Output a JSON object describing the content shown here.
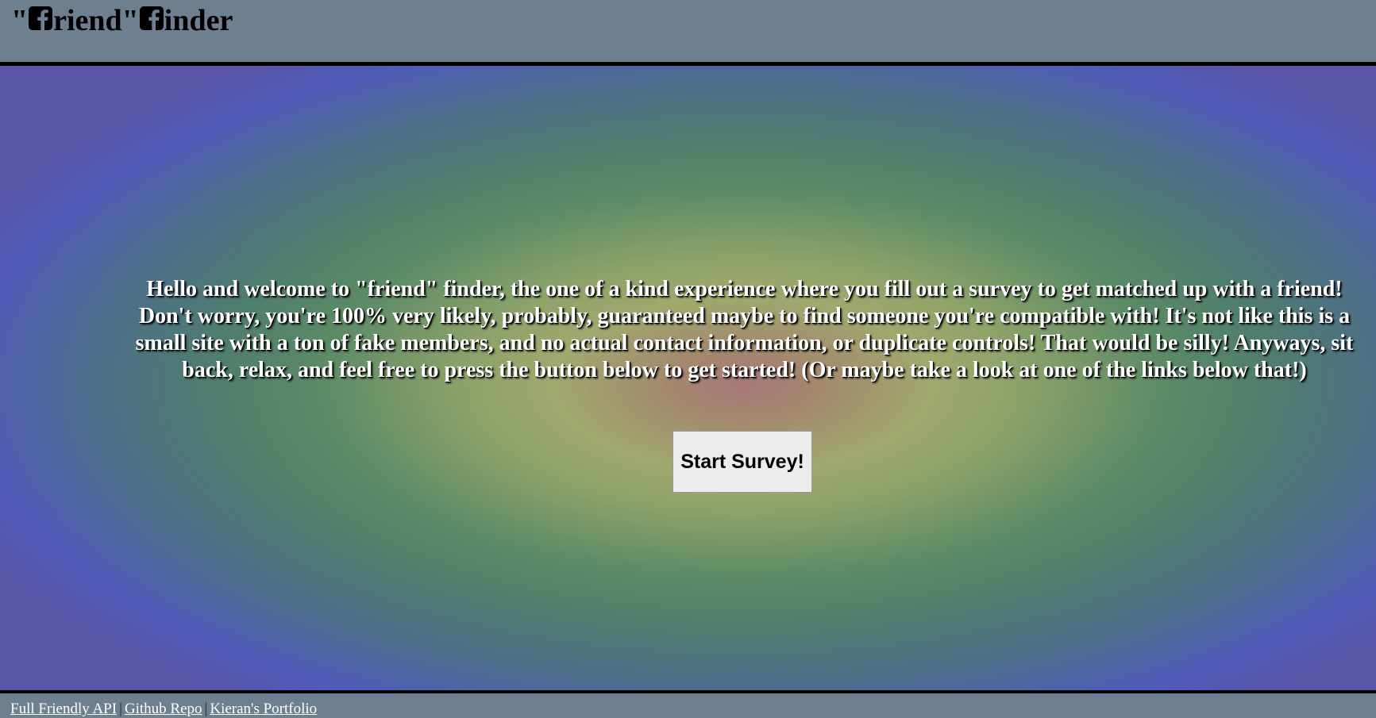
{
  "header": {
    "title_prefix": "\"",
    "title_mid1": "riend\" ",
    "title_mid2": "inder"
  },
  "main": {
    "intro_text": "Hello and welcome to \"friend\" finder, the one of a kind experience where you fill out a survey to get matched up with a friend! Don't worry, you're 100% very likely, probably, guaranteed maybe to find someone you're compatible with! It's not like this is a small site with a ton of fake members, and no actual contact information, or duplicate controls! That would be silly! Anyways, sit back, relax, and feel free to press the button below to get started! (Or maybe take a look at one of the links below that!)",
    "start_button_label": "Start Survey!"
  },
  "footer": {
    "links": [
      {
        "label": "Full Friendly API"
      },
      {
        "label": "Github Repo"
      },
      {
        "label": "Kieran's Portfolio"
      }
    ],
    "separator": "|"
  },
  "colors": {
    "header_bg": "#6e7f8f",
    "footer_bg": "#6e7f8f",
    "border": "#000000",
    "text_light": "#ffffff"
  },
  "icons": [
    "facebook-f-icon",
    "facebook-f-icon"
  ]
}
